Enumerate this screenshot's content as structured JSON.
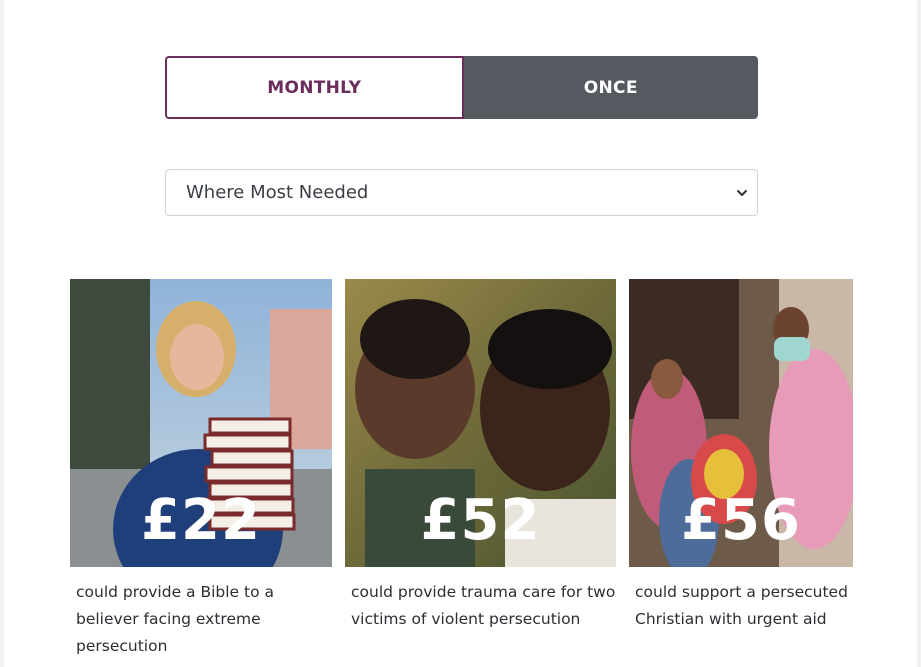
{
  "frequency": {
    "monthly_label": "MONTHLY",
    "once_label": "ONCE",
    "selected": "MONTHLY"
  },
  "fund_select": {
    "value": "Where Most Needed"
  },
  "cards": [
    {
      "amount": "£22",
      "caption": "could provide a Bible to a believer facing extreme persecution"
    },
    {
      "amount": "£52",
      "caption": "could provide trauma care for two victims of violent persecution"
    },
    {
      "amount": "£56",
      "caption": "could support a persecuted Christian with urgent aid"
    }
  ],
  "colors": {
    "accent": "#6b2d5c",
    "inactive": "#555a61"
  }
}
